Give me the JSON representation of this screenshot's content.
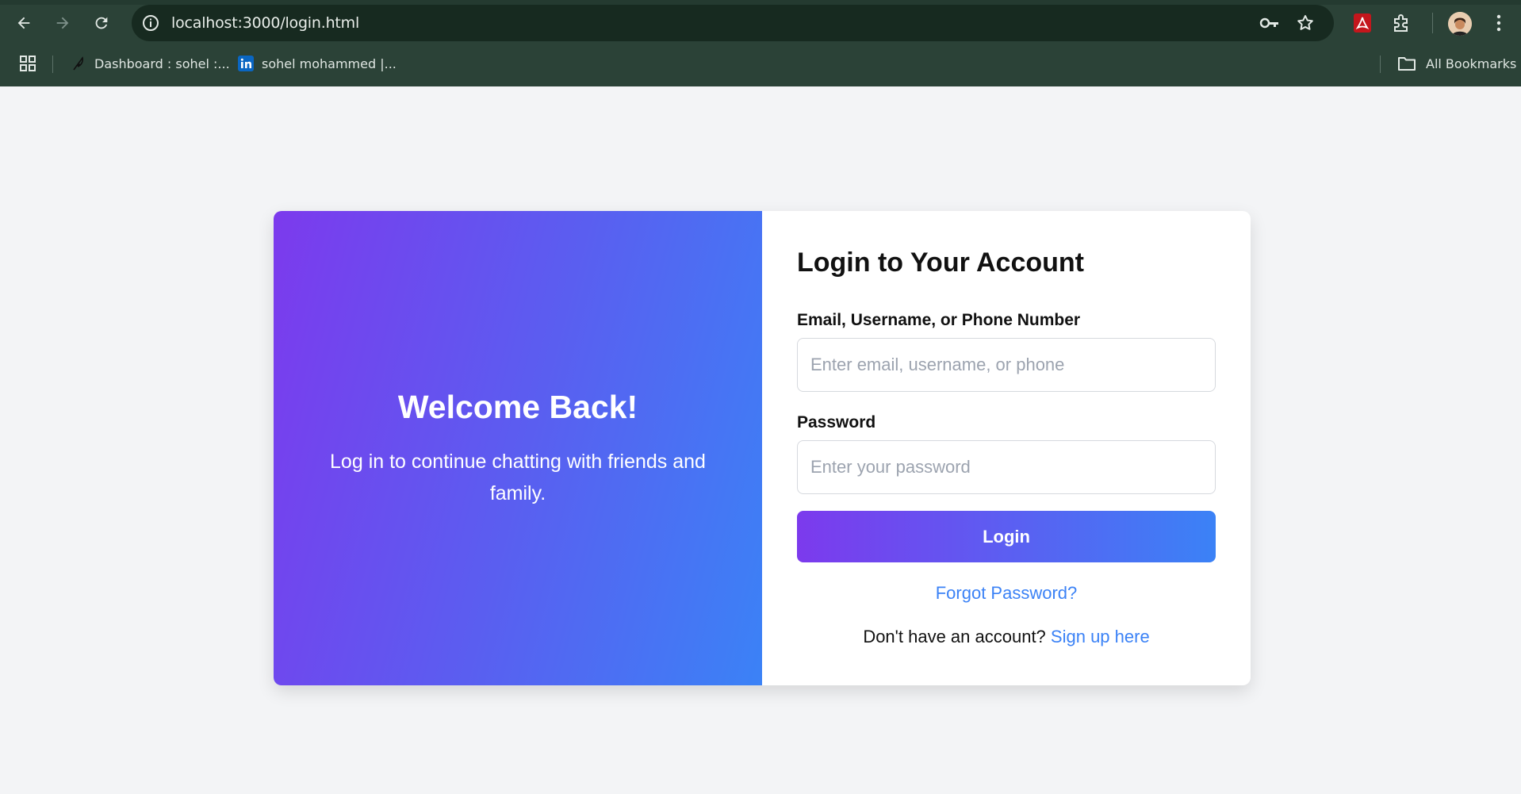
{
  "browser": {
    "url": "localhost:3000/login.html",
    "bookmarks": [
      {
        "label": "Dashboard : sohel :...",
        "icon": "feather-icon"
      },
      {
        "label": "sohel mohammed |...",
        "icon": "linkedin-icon"
      }
    ],
    "all_bookmarks_label": "All Bookmarks"
  },
  "hero": {
    "title": "Welcome Back!",
    "subtitle": "Log in to continue chatting with friends and family."
  },
  "login_form": {
    "title": "Login to Your Account",
    "identifier_label": "Email, Username, or Phone Number",
    "identifier_placeholder": "Enter email, username, or phone",
    "password_label": "Password",
    "password_placeholder": "Enter your password",
    "submit_label": "Login",
    "forgot_label": "Forgot Password?",
    "signup_prompt": "Don't have an account?",
    "signup_link": "Sign up here"
  },
  "colors": {
    "gradient_start": "#7c3aed",
    "gradient_end": "#3b82f6",
    "link": "#3b82f6",
    "page_background": "#f3f4f6",
    "chrome_background": "#2b4237"
  }
}
